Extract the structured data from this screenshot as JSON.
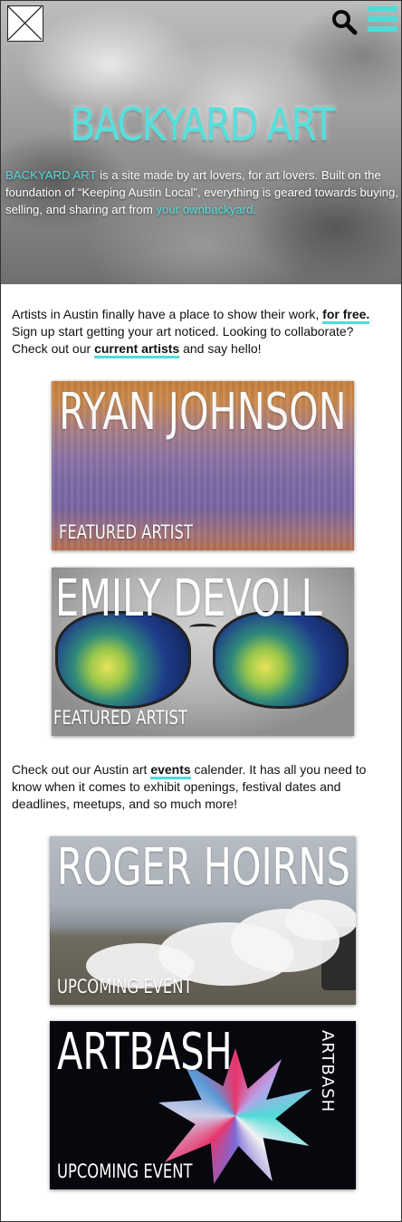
{
  "colors": {
    "accent": "#4fdcd8",
    "text": "#111111"
  },
  "header": {
    "logo_icon": "image-placeholder-icon",
    "search_icon": "search-icon",
    "menu_icon": "hamburger-menu-icon"
  },
  "hero": {
    "title": "BACKYARD ART",
    "intro_brand": "BACKYARD ART",
    "intro_text": " is a site made by art lovers, for art lovers. Built on the foundation of “Keeping Austin Local”, everything is geared towards buying, selling, and sharing art from ",
    "intro_link": "your ownbackyard."
  },
  "section1": {
    "text_a": "Artists in Austin finally have a place to show their work, ",
    "link_free": "for free.",
    "text_b": " Sign up start getting your art noticed. Looking to collaborate? Check out our ",
    "link_artists": "current artists",
    "text_c": " and say hello!"
  },
  "artists": [
    {
      "name": "RYAN JOHNSON",
      "tag": "FEATURED ARTIST"
    },
    {
      "name": "EMILY DEVOLL",
      "tag": "FEATURED ARTIST"
    }
  ],
  "section2": {
    "text_a": "Check out our Austin art ",
    "link_events": "events",
    "text_b": " calender. It has all you need to know when it comes to exhibit openings, festival dates and deadlines, meetups, and so much more!"
  },
  "events": [
    {
      "name": "ROGER HOIRNS",
      "tag": "UPCOMING EVENT"
    },
    {
      "name": "ARTBASH",
      "tag": "UPCOMING EVENT",
      "side_label": "ARTBASH"
    }
  ]
}
